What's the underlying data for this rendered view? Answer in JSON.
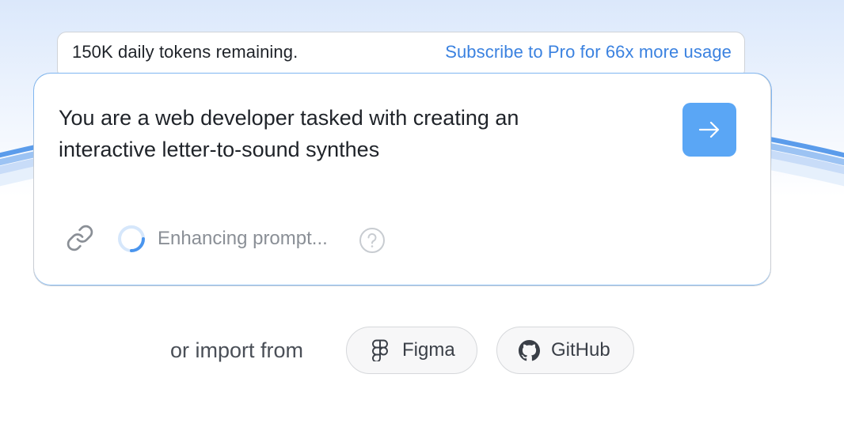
{
  "banner": {
    "tokens_text": "150K daily tokens remaining.",
    "upgrade_link": "Subscribe to Pro for 66x more usage"
  },
  "prompt": {
    "text": "You are a web developer tasked with creating an\ninteractive letter-to-sound synthes",
    "status": "Enhancing prompt..."
  },
  "import": {
    "label": "or import from",
    "options": [
      {
        "label": "Figma",
        "icon": "figma-icon"
      },
      {
        "label": "GitHub",
        "icon": "github-icon"
      }
    ]
  },
  "colors": {
    "accent": "#5aa6f5",
    "link": "#3b82e0",
    "arc": "#4f95ea"
  }
}
